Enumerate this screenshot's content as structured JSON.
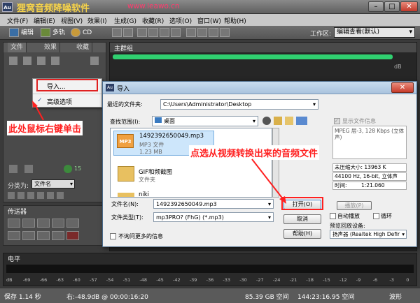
{
  "app": {
    "icon_text": "Au",
    "watermark": "狸窝音频降噪软件",
    "watermark_url": "www.leawo.cn"
  },
  "menu": [
    "文件(F)",
    "编辑(E)",
    "视图(V)",
    "效果(I)",
    "生成(G)",
    "收藏(R)",
    "选项(O)",
    "窗口(W)",
    "帮助(H)"
  ],
  "toolbar": {
    "edit": "编辑",
    "multitrack": "多轨",
    "cd": "CD",
    "workspace_label": "工作区:",
    "workspace_value": "编辑查看(默认)"
  },
  "left_panel": {
    "tabs": [
      "文件",
      "效果",
      "收藏"
    ],
    "sort_label": "分类为:",
    "sort_value": "文件名",
    "count": "15"
  },
  "context_menu": {
    "items": [
      "导入...",
      "高级选项"
    ]
  },
  "main": {
    "tab": "主群组",
    "db": "dB"
  },
  "transport": {
    "tab": "传送器"
  },
  "level": {
    "tab": "电平",
    "ticks": [
      "dB",
      "-69",
      "-66",
      "-63",
      "-60",
      "-57",
      "-54",
      "-51",
      "-48",
      "-45",
      "-42",
      "-39",
      "-36",
      "-33",
      "-30",
      "-27",
      "-24",
      "-21",
      "-18",
      "-15",
      "-12",
      "-9",
      "-6",
      "-3",
      "0"
    ]
  },
  "status": {
    "save": "保存 1.14 秒",
    "right": "右:-48.9dB @ 00:00:16:20",
    "disk": "85.39 GB 空间",
    "time": "144:23:16.95 空间",
    "wave": "波形"
  },
  "dialog": {
    "title": "导入",
    "recent_label": "最近的文件夹:",
    "recent_value": "C:\\Users\\Administrator\\Desktop",
    "lookin_label": "查找范围(I):",
    "lookin_value": "桌面",
    "files": [
      {
        "name": "1492392650049.mp3",
        "type": "MP3 文件",
        "size": "1.23 MB",
        "icon": "mp3-file-icon",
        "icon_text": "MP3"
      },
      {
        "name": "GIF和频截图",
        "type": "文件夹",
        "size": "",
        "icon": "folder-icon"
      },
      {
        "name": "niki",
        "type": "",
        "size": "",
        "icon": "folder-icon"
      }
    ],
    "filename_label": "文件名(N):",
    "filename_value": "1492392650049.mp3",
    "filetype_label": "文件类型(T):",
    "filetype_value": "mp3PRO? (FhG) (*.mp3)",
    "open_button": "打开(O)",
    "cancel_button": "取消",
    "help_button": "帮助(H)",
    "no_ask_label": "不询问更多的信息",
    "show_info_label": "显示文件信息",
    "info_text": "MPEG 层-3, 128 Kbps (立体声)",
    "uncompressed": "未压缩大小: 13963 K",
    "format": "44100 Hz, 16-bit, 立体声",
    "time_label": "时间:",
    "time_value": "1:21.060",
    "play_button": "播放(P)",
    "autoplay_label": "自动播放",
    "loop_label": "循环",
    "preview_label": "预览回放设备:",
    "device_value": "扬声器 (Realtek High Defir"
  },
  "annotations": {
    "right_click": "此处鼠标右键单击",
    "select_file": "点选从视频转换出来的音频文件"
  },
  "colors": {
    "annotation_red": "#ff2020",
    "highlight_blue": "#cde6fb",
    "progress_green": "#30d070"
  }
}
